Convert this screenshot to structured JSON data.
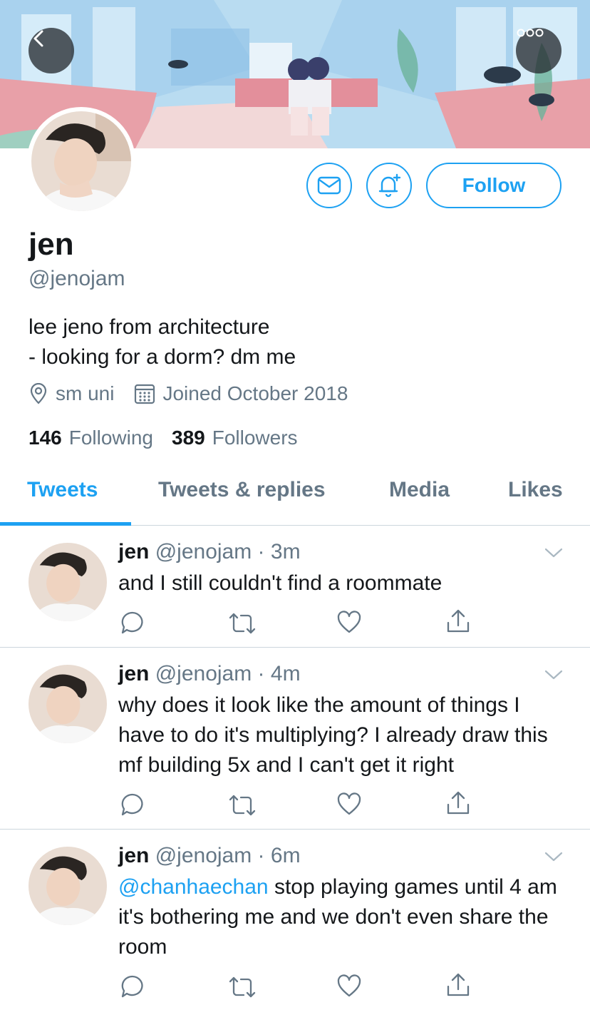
{
  "profile": {
    "name": "jen",
    "handle": "@jenojam",
    "bio_line1": "lee jeno from architecture",
    "bio_line2": "- looking for a dorm? dm me",
    "location": "sm uni",
    "joined": "Joined October 2018",
    "following_count": "146",
    "following_label": "Following",
    "followers_count": "389",
    "followers_label": "Followers",
    "follow_label": "Follow"
  },
  "tabs": [
    {
      "label": "Tweets",
      "active": true
    },
    {
      "label": "Tweets & replies",
      "active": false
    },
    {
      "label": "Media",
      "active": false
    },
    {
      "label": "Likes",
      "active": false
    }
  ],
  "tweets": [
    {
      "name": "jen",
      "handle": "@jenojam",
      "time": "3m",
      "text": "and I still couldn't find a roommate"
    },
    {
      "name": "jen",
      "handle": "@jenojam",
      "time": "4m",
      "text": "why does it look like the amount of things I have to do it's multiplying? I already draw this mf building 5x and I can't get it right"
    },
    {
      "name": "jen",
      "handle": "@jenojam",
      "time": "6m",
      "mention": "@chanhaechan",
      "text": " stop playing games until 4 am it's bothering me and we don't even share the room"
    }
  ],
  "icons": {
    "back": "chevron-left-icon",
    "more": "more-icon",
    "dm": "mail-icon",
    "notify": "bell-plus-icon",
    "location": "location-pin-icon",
    "calendar": "calendar-icon",
    "reply": "reply-icon",
    "retweet": "retweet-icon",
    "like": "heart-icon",
    "share": "share-icon",
    "chevron": "chevron-down-icon"
  },
  "colors": {
    "accent": "#1da1f2",
    "text": "#14171a",
    "secondary": "#657786",
    "divider": "#ccd6dd"
  }
}
